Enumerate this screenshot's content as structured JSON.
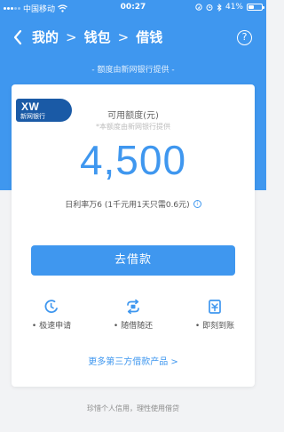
{
  "status_bar": {
    "carrier": "中国移动",
    "time": "00:27",
    "battery": "41%",
    "battery_level": 0.41,
    "signal_bars": 3,
    "icons": [
      "signal-icon",
      "wifi-icon",
      "location-icon",
      "alarm-icon",
      "bluetooth-icon",
      "battery-icon"
    ]
  },
  "nav": {
    "crumbs": [
      "我的",
      "钱包",
      "借钱"
    ],
    "separator": ">",
    "back_icon": "chevron-left-icon",
    "help_label": "?"
  },
  "provider_note": "- 额度由新网银行提供 -",
  "card": {
    "bank_badge": {
      "logo": "XW",
      "name": "新网银行"
    },
    "credit_label": "可用额度(元)",
    "credit_sub": "*本额度由新网银行提供",
    "credit_amount": "4,500",
    "rate_text": "日利率万6 (1千元用1天只需0.6元)",
    "info_label": "i",
    "borrow_button": "去借款",
    "features": [
      {
        "label": "极速申请",
        "icon": "moon-clock-icon"
      },
      {
        "label": "随借随还",
        "icon": "repeat-icon"
      },
      {
        "label": "即刻到账",
        "icon": "receipt-icon"
      }
    ],
    "more_link": "更多第三方借款产品 >"
  },
  "footer_note": "珍惜个人信用，理性使用借贷",
  "colors": {
    "primary": "#3f97ef",
    "bank_badge": "#1a5aa6",
    "background": "#f2f3f5"
  }
}
